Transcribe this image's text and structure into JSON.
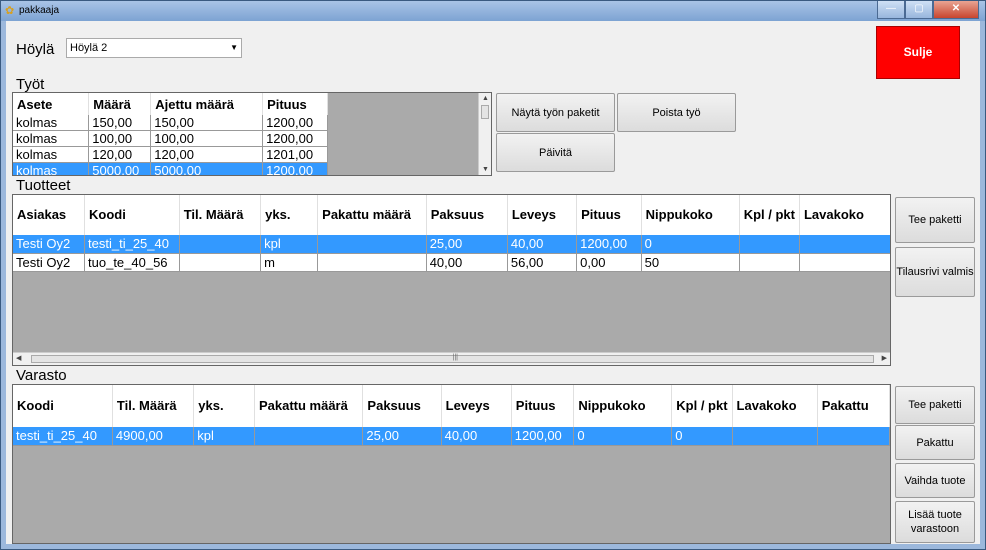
{
  "window": {
    "title": "pakkaaja",
    "minimize": "—",
    "maximize": "▢",
    "close": "✕"
  },
  "hoyla": {
    "label": "Höylä",
    "selected": "Höylä 2"
  },
  "sulje": "Sulje",
  "tyot": {
    "label": "Työt",
    "columns": [
      "Asete",
      "Määrä",
      "Ajettu määrä",
      "Pituus"
    ],
    "rows": [
      [
        "kolmas",
        "150,00",
        "150,00",
        "1200,00"
      ],
      [
        "kolmas",
        "100,00",
        "100,00",
        "1200,00"
      ],
      [
        "kolmas",
        "120,00",
        "120,00",
        "1201,00"
      ],
      [
        "kolmas",
        "5000,00",
        "5000,00",
        "1200,00"
      ]
    ],
    "buttons": {
      "nayta": "Näytä työn paketit",
      "poista": "Poista työ",
      "paivita": "Päivitä"
    }
  },
  "tuotteet": {
    "label": "Tuotteet",
    "columns": [
      "Asiakas",
      "Koodi",
      "Til. Määrä",
      "yks.",
      "Pakattu määrä",
      "Paksuus",
      "Leveys",
      "Pituus",
      "Nippukoko",
      "Kpl / pkt",
      "Lavakoko"
    ],
    "rows": [
      [
        "Testi Oy2",
        "testi_ti_25_40",
        "",
        "kpl",
        "",
        "25,00",
        "40,00",
        "1200,00",
        "0",
        "",
        ""
      ],
      [
        "Testi Oy2",
        "tuo_te_40_56",
        "",
        "m",
        "",
        "40,00",
        "56,00",
        "0,00",
        "50",
        "",
        ""
      ]
    ],
    "buttons": {
      "tee_paketti": "Tee paketti",
      "tilausrivi": "Tilausrivi valmis"
    }
  },
  "varasto": {
    "label": "Varasto",
    "columns": [
      "Koodi",
      "Til. Määrä",
      "yks.",
      "Pakattu määrä",
      "Paksuus",
      "Leveys",
      "Pituus",
      "Nippukoko",
      "Kpl / pkt",
      "Lavakoko",
      "Pakattu"
    ],
    "rows": [
      [
        "testi_ti_25_40",
        "4900,00",
        "kpl",
        "",
        "25,00",
        "40,00",
        "1200,00",
        "0",
        "0",
        "",
        ""
      ]
    ],
    "buttons": {
      "tee_paketti": "Tee paketti",
      "pakattu": "Pakattu",
      "vaihda": "Vaihda tuote",
      "lisaa": "Lisää tuote varastoon"
    }
  }
}
